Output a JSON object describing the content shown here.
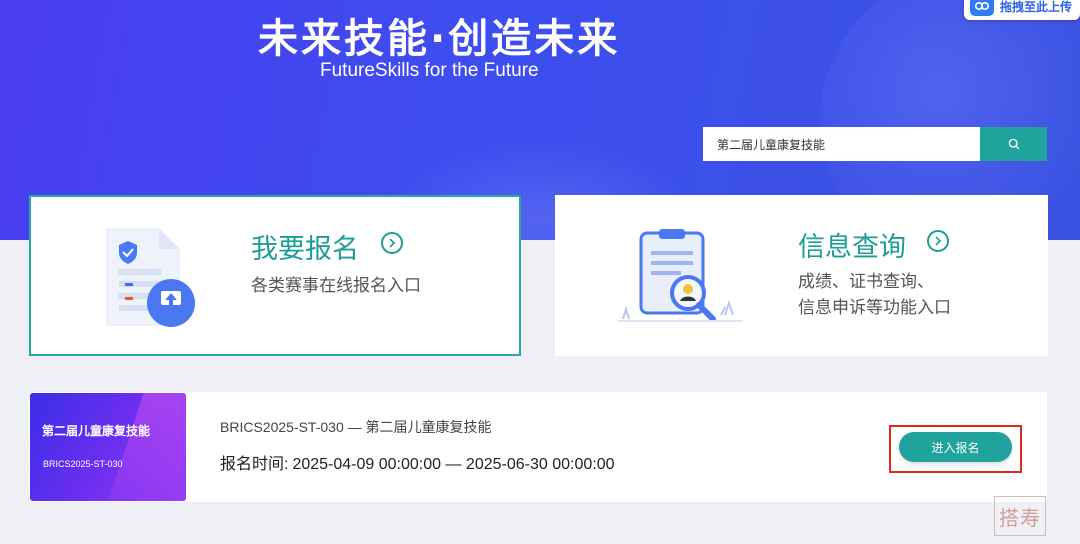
{
  "hero": {
    "title": "未来技能·创造未来",
    "subtitle": "FutureSkills  for the Future"
  },
  "upload": {
    "label": "拖拽至此上传",
    "icon": "cloud-link-icon"
  },
  "search": {
    "value": "第二届儿童康复技能",
    "button_icon": "search-icon"
  },
  "cards": {
    "register": {
      "title": "我要报名",
      "desc": "各类赛事在线报名入口"
    },
    "info": {
      "title": "信息查询",
      "desc_line1": "成绩、证书查询、",
      "desc_line2": "信息申诉等功能入口"
    }
  },
  "event": {
    "thumb_title": "第二届儿童康复技能",
    "thumb_code": "BRICS2025-ST-030",
    "code_line": "BRICS2025-ST-030 — 第二届儿童康复技能",
    "time_label": "报名时间:",
    "time_value": "2025-04-09 00:00:00 — 2025-06-30 00:00:00",
    "button": "进入报名"
  },
  "watermark": "搭寿",
  "colors": {
    "accent": "#1fa39c",
    "hero": "#3d4ef0",
    "highlight": "#e0271f"
  }
}
